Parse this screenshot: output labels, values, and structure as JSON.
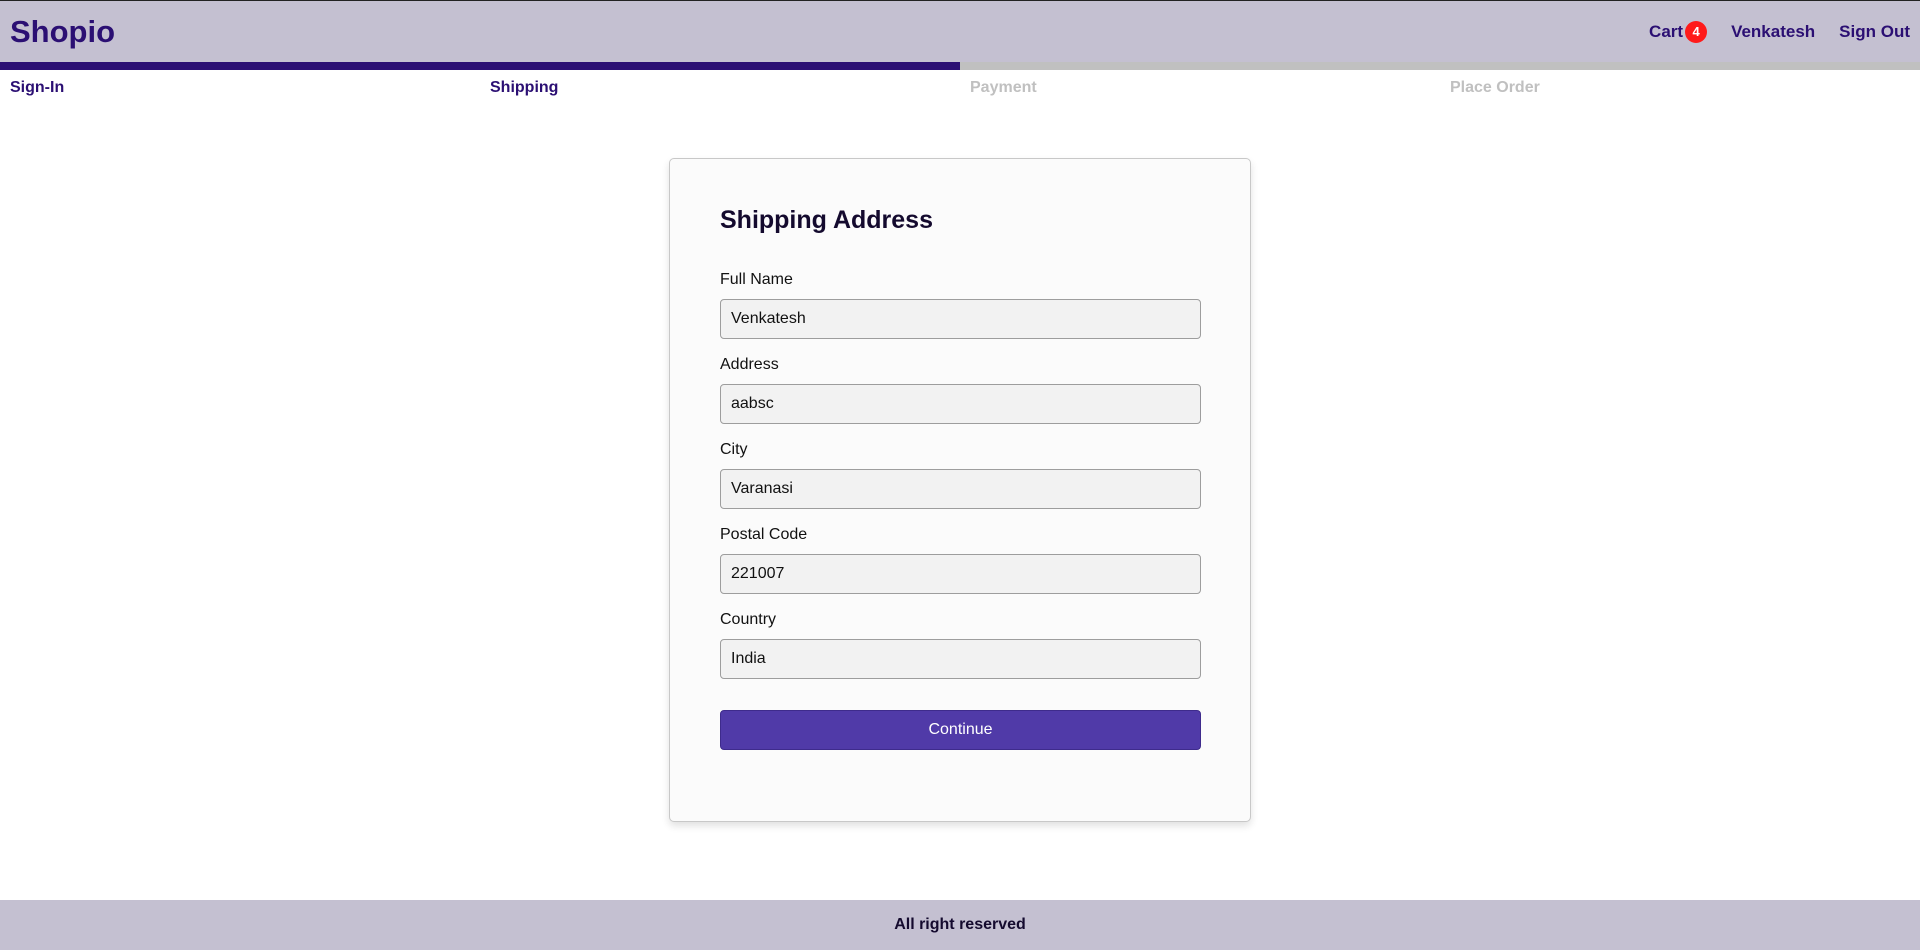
{
  "header": {
    "brand": "Shopio",
    "nav": {
      "cart_label": "Cart",
      "cart_count": "4",
      "user_name": "Venkatesh",
      "sign_out_label": "Sign Out"
    }
  },
  "steps": [
    {
      "label": "Sign-In",
      "active": true
    },
    {
      "label": "Shipping",
      "active": true
    },
    {
      "label": "Payment",
      "active": false
    },
    {
      "label": "Place Order",
      "active": false
    }
  ],
  "form": {
    "title": "Shipping Address",
    "fields": [
      {
        "label": "Full Name",
        "value": "Venkatesh"
      },
      {
        "label": "Address",
        "value": "aabsc"
      },
      {
        "label": "City",
        "value": "Varanasi"
      },
      {
        "label": "Postal Code",
        "value": "221007"
      },
      {
        "label": "Country",
        "value": "India"
      }
    ],
    "submit_label": "Continue"
  },
  "footer": {
    "text": "All right reserved"
  },
  "colors": {
    "brand": "#2b0f73",
    "header_bg": "#c4c0d1",
    "button": "#503aa8",
    "badge": "#ff1a1a",
    "inactive_step": "#c0c0c0"
  }
}
